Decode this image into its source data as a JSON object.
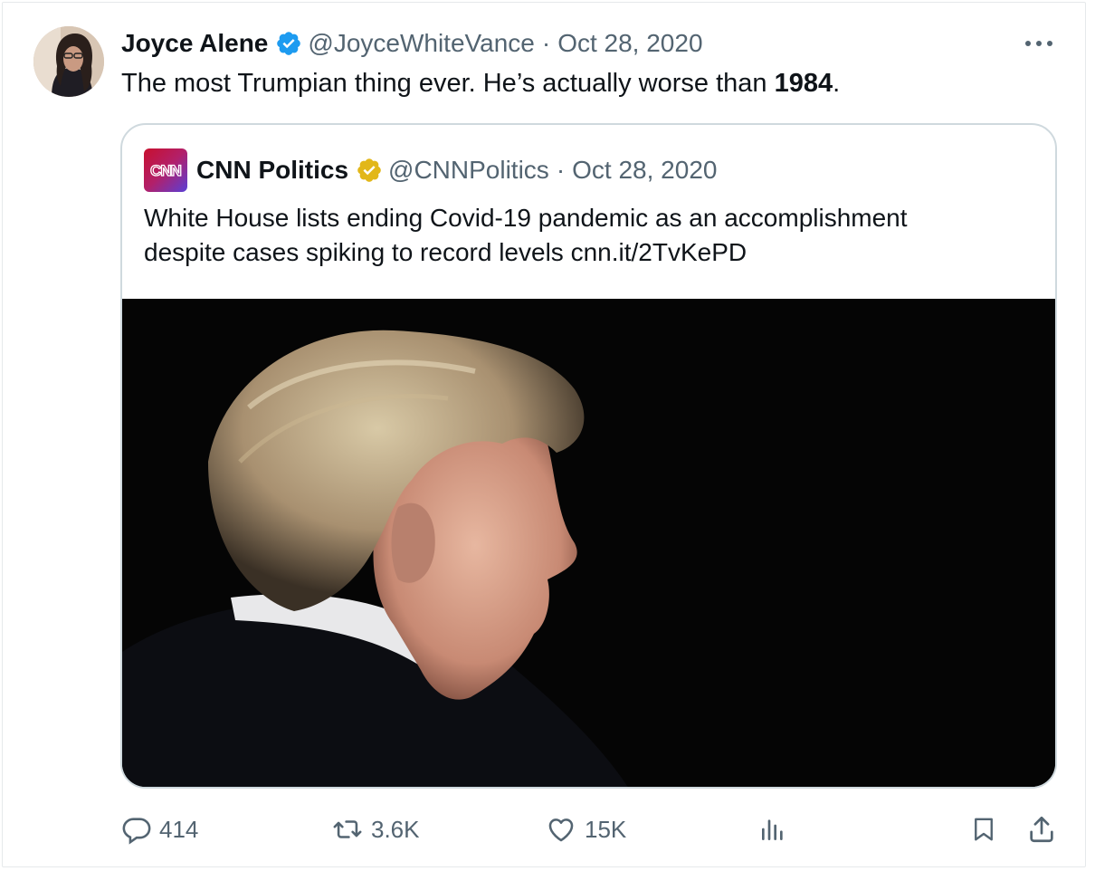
{
  "tweet": {
    "author_name": "Joyce Alene",
    "handle": "@JoyceWhiteVance",
    "date": "Oct 28, 2020",
    "separator": "·",
    "text_prefix": "The most Trumpian thing ever. He’s actually worse than ",
    "text_bold": "1984",
    "text_suffix": ".",
    "more_icon": "more-horizontal-icon"
  },
  "quote": {
    "author_name": "CNN Politics",
    "handle": "@CNNPolitics",
    "date": "Oct 28, 2020",
    "separator": "·",
    "logo_text": "CNN",
    "text_line1": "White House lists ending Covid-19 pandemic as an accomplishment",
    "text_line2": "despite cases spiking to record levels cnn.it/2TvKePD"
  },
  "actions": {
    "replies": "414",
    "retweets": "3.6K",
    "likes": "15K"
  },
  "colors": {
    "verified_blue": "#1d9bf0",
    "verified_gold": "#e2b719",
    "secondary_text": "#536471",
    "border": "#cfd9de"
  }
}
